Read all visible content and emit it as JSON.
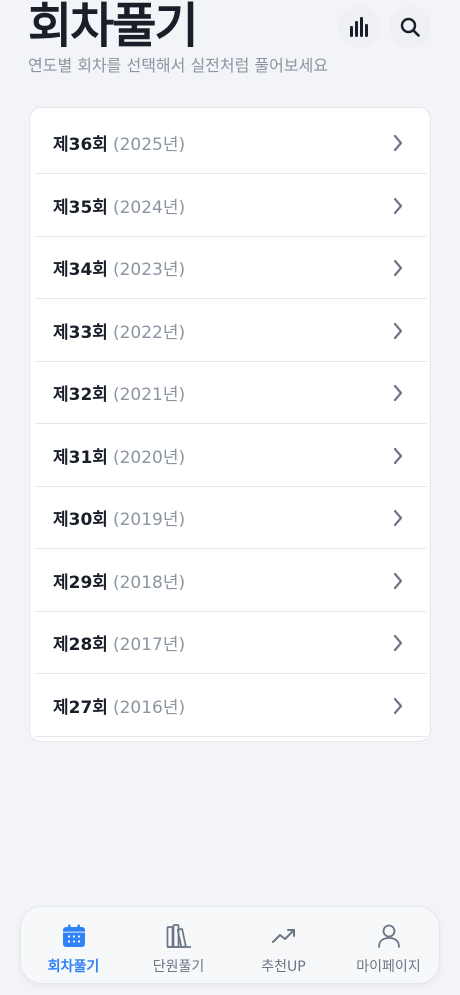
{
  "header": {
    "title": "회차풀기",
    "subtitle": "연도별 회차를 선택해서 실전처럼 풀어보세요",
    "icons": [
      "bar-chart-icon",
      "search-icon"
    ]
  },
  "rounds": [
    {
      "label": "제36회",
      "year": "(2025년)"
    },
    {
      "label": "제35회",
      "year": "(2024년)"
    },
    {
      "label": "제34회",
      "year": "(2023년)"
    },
    {
      "label": "제33회",
      "year": "(2022년)"
    },
    {
      "label": "제32회",
      "year": "(2021년)"
    },
    {
      "label": "제31회",
      "year": "(2020년)"
    },
    {
      "label": "제30회",
      "year": "(2019년)"
    },
    {
      "label": "제29회",
      "year": "(2018년)"
    },
    {
      "label": "제28회",
      "year": "(2017년)"
    },
    {
      "label": "제27회",
      "year": "(2016년)"
    }
  ],
  "nav": {
    "items": [
      {
        "label": "회차풀기",
        "icon": "calendar-icon",
        "active": true
      },
      {
        "label": "단원풀기",
        "icon": "books-icon",
        "active": false
      },
      {
        "label": "추천UP",
        "icon": "trending-up-icon",
        "active": false
      },
      {
        "label": "마이페이지",
        "icon": "user-icon",
        "active": false
      }
    ]
  },
  "colors": {
    "accent": "#3182f6",
    "text_primary": "#191f28",
    "text_secondary": "#8b95a1",
    "background": "#f2f4f7"
  }
}
